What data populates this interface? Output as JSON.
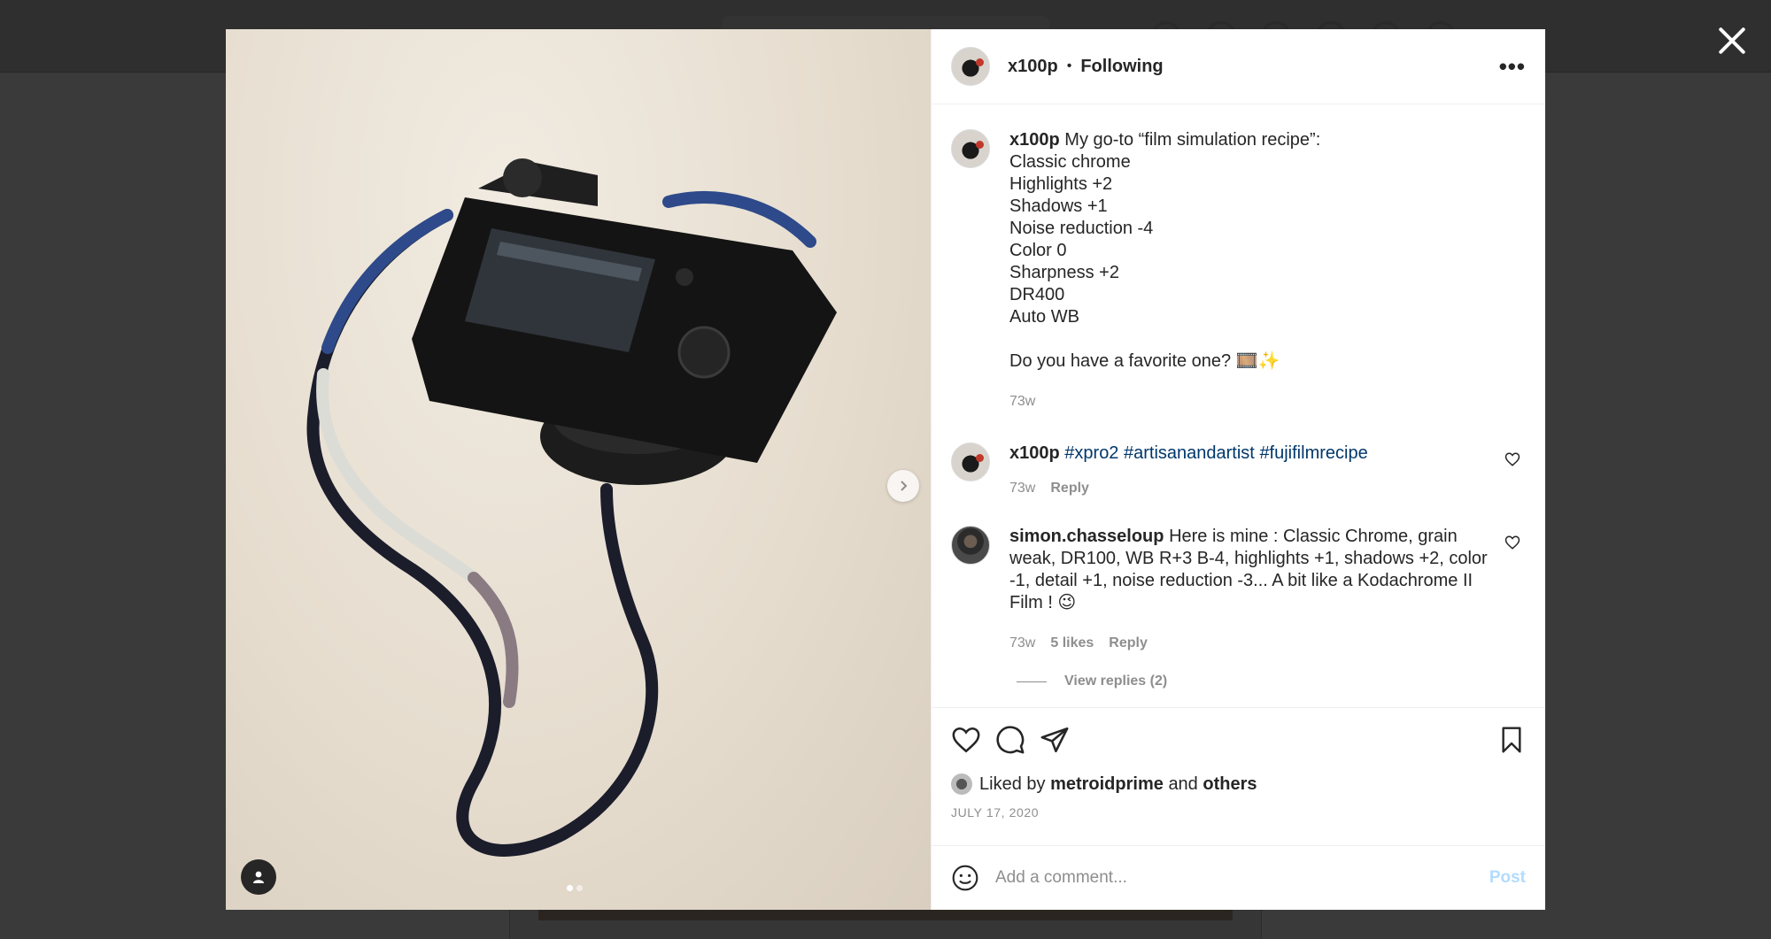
{
  "post": {
    "author": "x100p",
    "separator": "•",
    "follow_status": "Following",
    "more_label": "•••"
  },
  "caption": {
    "user": "x100p",
    "lines": [
      "My go-to “film simulation recipe”:",
      "Classic chrome",
      "Highlights +2",
      "Shadows +1",
      "Noise reduction -4",
      "Color 0",
      "Sharpness +2",
      "DR400",
      "Auto WB",
      "",
      "Do you have a favorite one? 🎞️✨"
    ],
    "age": "73w"
  },
  "comments": [
    {
      "user": "x100p",
      "tags": [
        "#xpro2",
        "#artisanandartist",
        "#fujifilmrecipe"
      ],
      "age": "73w",
      "reply": "Reply"
    },
    {
      "user": "simon.chasseloup",
      "text": "Here is mine : Classic Chrome, grain weak, DR100, WB R+3 B-4, highlights +1, shadows +2, color -1, detail +1, noise reduction -3... A bit like a Kodachrome II Film ! 😉",
      "age": "73w",
      "likes": "5 likes",
      "reply": "Reply",
      "view_replies": "View replies (2)"
    }
  ],
  "likes": {
    "prefix": "Liked by",
    "user": "metroidprime",
    "and": "and",
    "others": "others"
  },
  "date": "JULY 17, 2020",
  "add_comment": {
    "placeholder": "Add a comment...",
    "post_label": "Post"
  },
  "carousel": {
    "count": 2,
    "active": 0
  },
  "colors": {
    "link": "#00376b",
    "muted": "#8e8e8e",
    "post_disabled": "#b3dbff"
  }
}
